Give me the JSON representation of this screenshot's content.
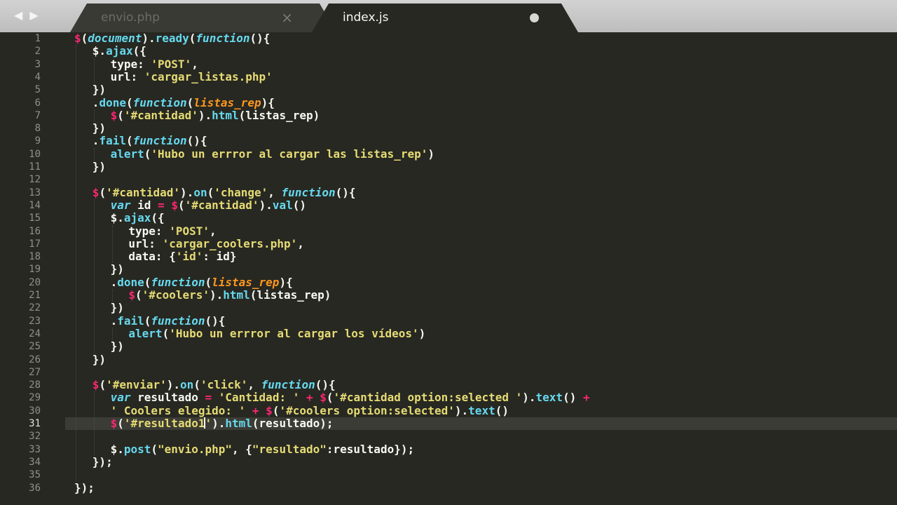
{
  "tabs": [
    {
      "label": "envio.php",
      "active": false,
      "close_glyph": "×"
    },
    {
      "label": "index.js",
      "active": true,
      "dirty": true
    }
  ],
  "nav": {
    "back": "◀",
    "forward": "▶"
  },
  "current_line": 31,
  "colors": {
    "background": "#272822",
    "text": "#f8f8f2",
    "string": "#e6db74",
    "keyword_call": "#66d9ef",
    "operator": "#f92672",
    "parameter": "#fd971f"
  },
  "lines": [
    {
      "n": "1",
      "indent": 0,
      "tokens": [
        [
          "op",
          "$"
        ],
        [
          "plain",
          "("
        ],
        [
          "fn",
          "document"
        ],
        [
          "plain",
          ")."
        ],
        [
          "call",
          "ready"
        ],
        [
          "plain",
          "("
        ],
        [
          "fn",
          "function"
        ],
        [
          "plain",
          "(){"
        ]
      ]
    },
    {
      "n": "2",
      "indent": 2,
      "tokens": [
        [
          "plain",
          "$."
        ],
        [
          "call",
          "ajax"
        ],
        [
          "plain",
          "({"
        ]
      ]
    },
    {
      "n": "3",
      "indent": 4,
      "tokens": [
        [
          "plain",
          "type: "
        ],
        [
          "str",
          "'POST'"
        ],
        [
          "plain",
          ","
        ]
      ]
    },
    {
      "n": "4",
      "indent": 4,
      "tokens": [
        [
          "plain",
          "url: "
        ],
        [
          "str",
          "'cargar_listas.php'"
        ]
      ]
    },
    {
      "n": "5",
      "indent": 2,
      "tokens": [
        [
          "plain",
          "})"
        ]
      ]
    },
    {
      "n": "6",
      "indent": 2,
      "tokens": [
        [
          "plain",
          "."
        ],
        [
          "call",
          "done"
        ],
        [
          "plain",
          "("
        ],
        [
          "fn",
          "function"
        ],
        [
          "plain",
          "("
        ],
        [
          "param",
          "listas_rep"
        ],
        [
          "plain",
          "){"
        ]
      ]
    },
    {
      "n": "7",
      "indent": 4,
      "tokens": [
        [
          "op",
          "$"
        ],
        [
          "plain",
          "("
        ],
        [
          "str",
          "'#cantidad'"
        ],
        [
          "plain",
          ")."
        ],
        [
          "call",
          "html"
        ],
        [
          "plain",
          "(listas_rep)"
        ]
      ]
    },
    {
      "n": "8",
      "indent": 2,
      "tokens": [
        [
          "plain",
          "})"
        ]
      ]
    },
    {
      "n": "9",
      "indent": 2,
      "tokens": [
        [
          "plain",
          "."
        ],
        [
          "call",
          "fail"
        ],
        [
          "plain",
          "("
        ],
        [
          "fn",
          "function"
        ],
        [
          "plain",
          "(){"
        ]
      ]
    },
    {
      "n": "10",
      "indent": 4,
      "tokens": [
        [
          "call",
          "alert"
        ],
        [
          "plain",
          "("
        ],
        [
          "str",
          "'Hubo un errror al cargar las listas_rep'"
        ],
        [
          "plain",
          ")"
        ]
      ]
    },
    {
      "n": "11",
      "indent": 2,
      "tokens": [
        [
          "plain",
          "})"
        ]
      ]
    },
    {
      "n": "12",
      "indent": 0,
      "tokens": []
    },
    {
      "n": "13",
      "indent": 2,
      "tokens": [
        [
          "op",
          "$"
        ],
        [
          "plain",
          "("
        ],
        [
          "str",
          "'#cantidad'"
        ],
        [
          "plain",
          ")."
        ],
        [
          "call",
          "on"
        ],
        [
          "plain",
          "("
        ],
        [
          "str",
          "'change'"
        ],
        [
          "plain",
          ", "
        ],
        [
          "fn",
          "function"
        ],
        [
          "plain",
          "(){"
        ]
      ]
    },
    {
      "n": "14",
      "indent": 4,
      "tokens": [
        [
          "fn",
          "var"
        ],
        [
          "plain",
          " id "
        ],
        [
          "op",
          "="
        ],
        [
          "plain",
          " "
        ],
        [
          "op",
          "$"
        ],
        [
          "plain",
          "("
        ],
        [
          "str",
          "'#cantidad'"
        ],
        [
          "plain",
          ")."
        ],
        [
          "call",
          "val"
        ],
        [
          "plain",
          "()"
        ]
      ]
    },
    {
      "n": "15",
      "indent": 4,
      "tokens": [
        [
          "plain",
          "$."
        ],
        [
          "call",
          "ajax"
        ],
        [
          "plain",
          "({"
        ]
      ]
    },
    {
      "n": "16",
      "indent": 6,
      "tokens": [
        [
          "plain",
          "type: "
        ],
        [
          "str",
          "'POST'"
        ],
        [
          "plain",
          ","
        ]
      ]
    },
    {
      "n": "17",
      "indent": 6,
      "tokens": [
        [
          "plain",
          "url: "
        ],
        [
          "str",
          "'cargar_coolers.php'"
        ],
        [
          "plain",
          ","
        ]
      ]
    },
    {
      "n": "18",
      "indent": 6,
      "tokens": [
        [
          "plain",
          "data: {"
        ],
        [
          "str",
          "'id'"
        ],
        [
          "plain",
          ": id}"
        ]
      ]
    },
    {
      "n": "19",
      "indent": 4,
      "tokens": [
        [
          "plain",
          "})"
        ]
      ]
    },
    {
      "n": "20",
      "indent": 4,
      "tokens": [
        [
          "plain",
          "."
        ],
        [
          "call",
          "done"
        ],
        [
          "plain",
          "("
        ],
        [
          "fn",
          "function"
        ],
        [
          "plain",
          "("
        ],
        [
          "param",
          "listas_rep"
        ],
        [
          "plain",
          "){"
        ]
      ]
    },
    {
      "n": "21",
      "indent": 6,
      "tokens": [
        [
          "op",
          "$"
        ],
        [
          "plain",
          "("
        ],
        [
          "str",
          "'#coolers'"
        ],
        [
          "plain",
          ")."
        ],
        [
          "call",
          "html"
        ],
        [
          "plain",
          "(listas_rep)"
        ]
      ]
    },
    {
      "n": "22",
      "indent": 4,
      "tokens": [
        [
          "plain",
          "})"
        ]
      ]
    },
    {
      "n": "23",
      "indent": 4,
      "tokens": [
        [
          "plain",
          "."
        ],
        [
          "call",
          "fail"
        ],
        [
          "plain",
          "("
        ],
        [
          "fn",
          "function"
        ],
        [
          "plain",
          "(){"
        ]
      ]
    },
    {
      "n": "24",
      "indent": 6,
      "tokens": [
        [
          "call",
          "alert"
        ],
        [
          "plain",
          "("
        ],
        [
          "str",
          "'Hubo un errror al cargar los vídeos'"
        ],
        [
          "plain",
          ")"
        ]
      ]
    },
    {
      "n": "25",
      "indent": 4,
      "tokens": [
        [
          "plain",
          "})"
        ]
      ]
    },
    {
      "n": "26",
      "indent": 2,
      "tokens": [
        [
          "plain",
          "})"
        ]
      ]
    },
    {
      "n": "27",
      "indent": 0,
      "tokens": []
    },
    {
      "n": "28",
      "indent": 2,
      "tokens": [
        [
          "op",
          "$"
        ],
        [
          "plain",
          "("
        ],
        [
          "str",
          "'#enviar'"
        ],
        [
          "plain",
          ")."
        ],
        [
          "call",
          "on"
        ],
        [
          "plain",
          "("
        ],
        [
          "str",
          "'click'"
        ],
        [
          "plain",
          ", "
        ],
        [
          "fn",
          "function"
        ],
        [
          "plain",
          "(){"
        ]
      ]
    },
    {
      "n": "29",
      "indent": 4,
      "tokens": [
        [
          "fn",
          "var"
        ],
        [
          "plain",
          " resultado "
        ],
        [
          "op",
          "="
        ],
        [
          "plain",
          " "
        ],
        [
          "str",
          "'Cantidad: '"
        ],
        [
          "plain",
          " "
        ],
        [
          "op",
          "+"
        ],
        [
          "plain",
          " "
        ],
        [
          "op",
          "$"
        ],
        [
          "plain",
          "("
        ],
        [
          "str",
          "'#cantidad option:selected '"
        ],
        [
          "plain",
          ")."
        ],
        [
          "call",
          "text"
        ],
        [
          "plain",
          "() "
        ],
        [
          "op",
          "+"
        ]
      ]
    },
    {
      "n": "30",
      "indent": 4,
      "tokens": [
        [
          "str",
          "' Coolers elegido: '"
        ],
        [
          "plain",
          " "
        ],
        [
          "op",
          "+"
        ],
        [
          "plain",
          " "
        ],
        [
          "op",
          "$"
        ],
        [
          "plain",
          "("
        ],
        [
          "str",
          "'#coolers option:selected'"
        ],
        [
          "plain",
          ")."
        ],
        [
          "call",
          "text"
        ],
        [
          "plain",
          "()"
        ]
      ]
    },
    {
      "n": "31",
      "indent": 4,
      "tokens": [
        [
          "op",
          "$"
        ],
        [
          "plain",
          "("
        ],
        [
          "str",
          "'#resultado1"
        ],
        [
          "caret",
          ""
        ],
        [
          "str",
          "'"
        ],
        [
          "plain",
          ")."
        ],
        [
          "call",
          "html"
        ],
        [
          "plain",
          "(resultado);"
        ]
      ]
    },
    {
      "n": "32",
      "indent": 0,
      "tokens": []
    },
    {
      "n": "33",
      "indent": 4,
      "tokens": [
        [
          "plain",
          "$."
        ],
        [
          "call",
          "post"
        ],
        [
          "plain",
          "("
        ],
        [
          "str",
          "\"envio.php\""
        ],
        [
          "plain",
          ", {"
        ],
        [
          "str",
          "\"resultado\""
        ],
        [
          "plain",
          ":resultado});"
        ]
      ]
    },
    {
      "n": "34",
      "indent": 2,
      "tokens": [
        [
          "plain",
          "});"
        ]
      ]
    },
    {
      "n": "35",
      "indent": 0,
      "tokens": []
    },
    {
      "n": "36",
      "indent": 0,
      "tokens": [
        [
          "plain",
          "});"
        ]
      ]
    }
  ]
}
